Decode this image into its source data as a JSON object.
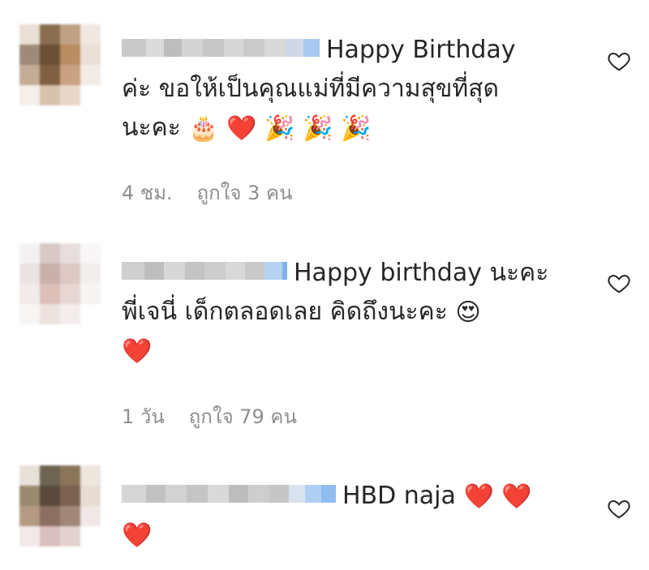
{
  "comments": [
    {
      "text_line1": "Happy Birthday",
      "text_line2": "ค่ะ ขอให้เป็นคุณแม่ที่มีความสุขที่สุด",
      "text_line3": "นะคะ",
      "emojis": [
        "🎂",
        "❤️",
        "🎉",
        "🎉",
        "🎉"
      ],
      "time": "4 ชม.",
      "likes": "ถูกใจ 3 คน",
      "icon": "heart-outline-icon",
      "avatar_colors": [
        "#e9dfd4",
        "#8a6e50",
        "#c0a183",
        "#f0e8e0",
        "#9d8a78",
        "#6a4f35",
        "#b98c62",
        "#eadfd5",
        "#c4ad96",
        "#805f42",
        "#caa183",
        "#f3ece6",
        "#f5efe9",
        "#d7c2ae",
        "#e8d7c8",
        "#ffffff"
      ]
    },
    {
      "text_line1": "Happy birthday นะคะ",
      "text_line2": "พี่เจนี่ เด็กตลอดเลย คิดถึงนะคะ",
      "emoji_line2": "😍",
      "emojis_line3": [
        "❤️"
      ],
      "time": "1 วัน",
      "likes": "ถูกใจ 79 คน",
      "icon": "heart-outline-icon",
      "avatar_colors": [
        "#f4f1f2",
        "#d8c9c8",
        "#e9dede",
        "#f8f6f6",
        "#eae3e3",
        "#c9b0a8",
        "#ddc8c3",
        "#f3eeee",
        "#f1ebea",
        "#dcc0b8",
        "#e7d6d2",
        "#f6f3f3",
        "#f8f5f5",
        "#ece2e0",
        "#f3eeed",
        "#ffffff"
      ]
    },
    {
      "text_line1": "HBD naja",
      "emojis_line1": [
        "❤️",
        "❤️"
      ],
      "emojis_line2": [
        "❤️"
      ],
      "icon": "heart-outline-icon",
      "avatar_colors": [
        "#e8e1d8",
        "#6d6452",
        "#8b7559",
        "#ece6df",
        "#9a8a6f",
        "#5a4a3c",
        "#7c614f",
        "#e6dcd4",
        "#b49a83",
        "#8d6f61",
        "#a08777",
        "#efe8e6",
        "#f3e9e8",
        "#d8c0c0",
        "#e4d2d1",
        "#ffffff"
      ]
    }
  ]
}
